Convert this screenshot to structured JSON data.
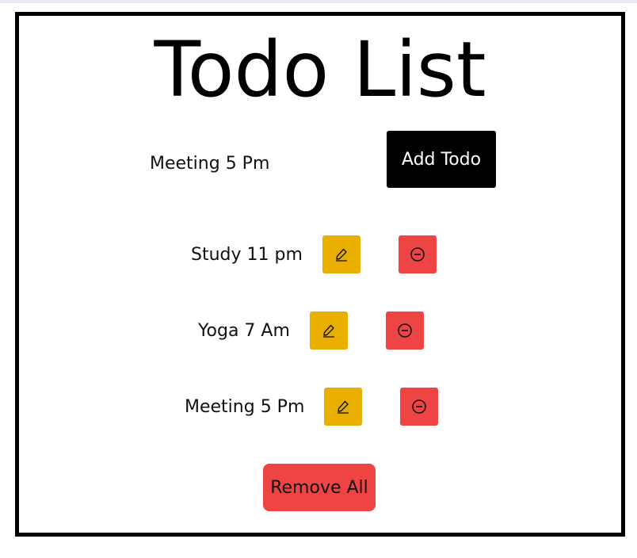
{
  "title": "Todo List",
  "input": {
    "value": "Meeting 5 Pm"
  },
  "add_button_label": "Add Todo",
  "todos": [
    {
      "text": "Study 11 pm"
    },
    {
      "text": "Yoga 7 Am"
    },
    {
      "text": "Meeting 5 Pm"
    }
  ],
  "remove_all_label": "Remove All",
  "icons": {
    "edit": "pencil-icon",
    "delete": "minus-circle-icon"
  },
  "colors": {
    "edit": "#e8ae00",
    "delete": "#ef4444",
    "add_button": "#000000"
  }
}
